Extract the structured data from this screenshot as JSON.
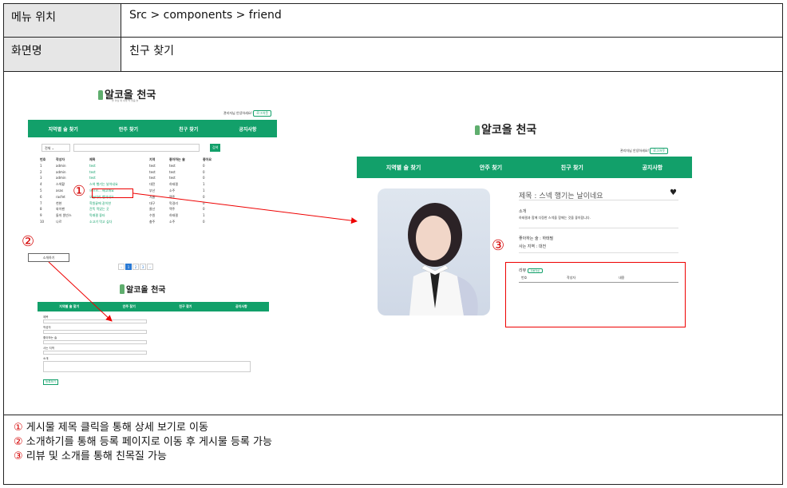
{
  "header": {
    "menu_label": "메뉴 위치",
    "menu_value": "Src > components > friend",
    "screen_label": "화면명",
    "screen_value": "친구 찾기"
  },
  "app": {
    "logo_text": "알코올 천국",
    "logo_sub": "술 마실 때 내게 딱 맞춤 술",
    "welcome": "관리자님 안녕하세요!",
    "logout": "로그아웃",
    "nav": [
      "지역별 술 찾기",
      "안주 찾기",
      "친구 찾기",
      "공지사항"
    ]
  },
  "list": {
    "filter": "전체",
    "search_btn": "검색",
    "columns": [
      "번호",
      "작성자",
      "제목",
      "지역",
      "좋아하는 술",
      "좋아요"
    ],
    "rows": [
      [
        "1",
        "admin",
        "test",
        "test",
        "test",
        "0"
      ],
      [
        "2",
        "admin",
        "test",
        "test",
        "test",
        "0"
      ],
      [
        "3",
        "admin",
        "test",
        "test",
        "test",
        "0"
      ],
      [
        "4",
        "스색황",
        "스색 행기는 날이네요",
        "대전",
        "하태필",
        "1"
      ],
      [
        "5",
        "asas",
        "으으으... 배고파요",
        "부산",
        "소주",
        "1"
      ],
      [
        "6",
        "racfet",
        "오늘따라 행가네요",
        "서울",
        "맥주",
        "0"
      ],
      [
        "7",
        "천현",
        "학원끝에 같이한",
        "대구",
        "막걸리",
        "0"
      ],
      [
        "8",
        "와이팬",
        "잔뜩 먹었는 곳",
        "울산",
        "맥주",
        "0"
      ],
      [
        "9",
        "돌쉬 원빈스",
        "막래필 좋타",
        "수원",
        "하태필",
        "1"
      ],
      [
        "10",
        "나르",
        "소고기 먹고 싶다",
        "충주",
        "소주",
        "0"
      ]
    ],
    "write_btn": "소개하기",
    "pages": [
      "‹",
      "1",
      "2",
      "3",
      "›"
    ]
  },
  "detail": {
    "title": "제목 : 스넥 행기는 날이네요",
    "intro_label": "소개",
    "intro_text": "하태필과 함께 다정한 스넥을 함께는 것을 좋아합니다.",
    "drink": "좋아하는 술 : 하태필",
    "region": "사는 지역 : 대전",
    "review_label": "리뷰",
    "review_btn": "리뷰작성",
    "review_cols": [
      "번호",
      "작성자",
      "내용"
    ]
  },
  "form": {
    "fields": [
      "제목",
      "작성자",
      "좋아하는 술",
      "사는 지역",
      "소개"
    ],
    "submit": "등록하기"
  },
  "markers": [
    "①",
    "②",
    "③"
  ],
  "notes": [
    {
      "num": "①",
      "text": " 게시물 제목 클릭을 통해 상세 보기로 이동"
    },
    {
      "num": "②",
      "text": " 소개하기를 통해 등록 페이지로 이동 후 게시물 등록 가능"
    },
    {
      "num": "③",
      "text": " 리뷰 및 소개를 통해 친목질 가능"
    }
  ]
}
